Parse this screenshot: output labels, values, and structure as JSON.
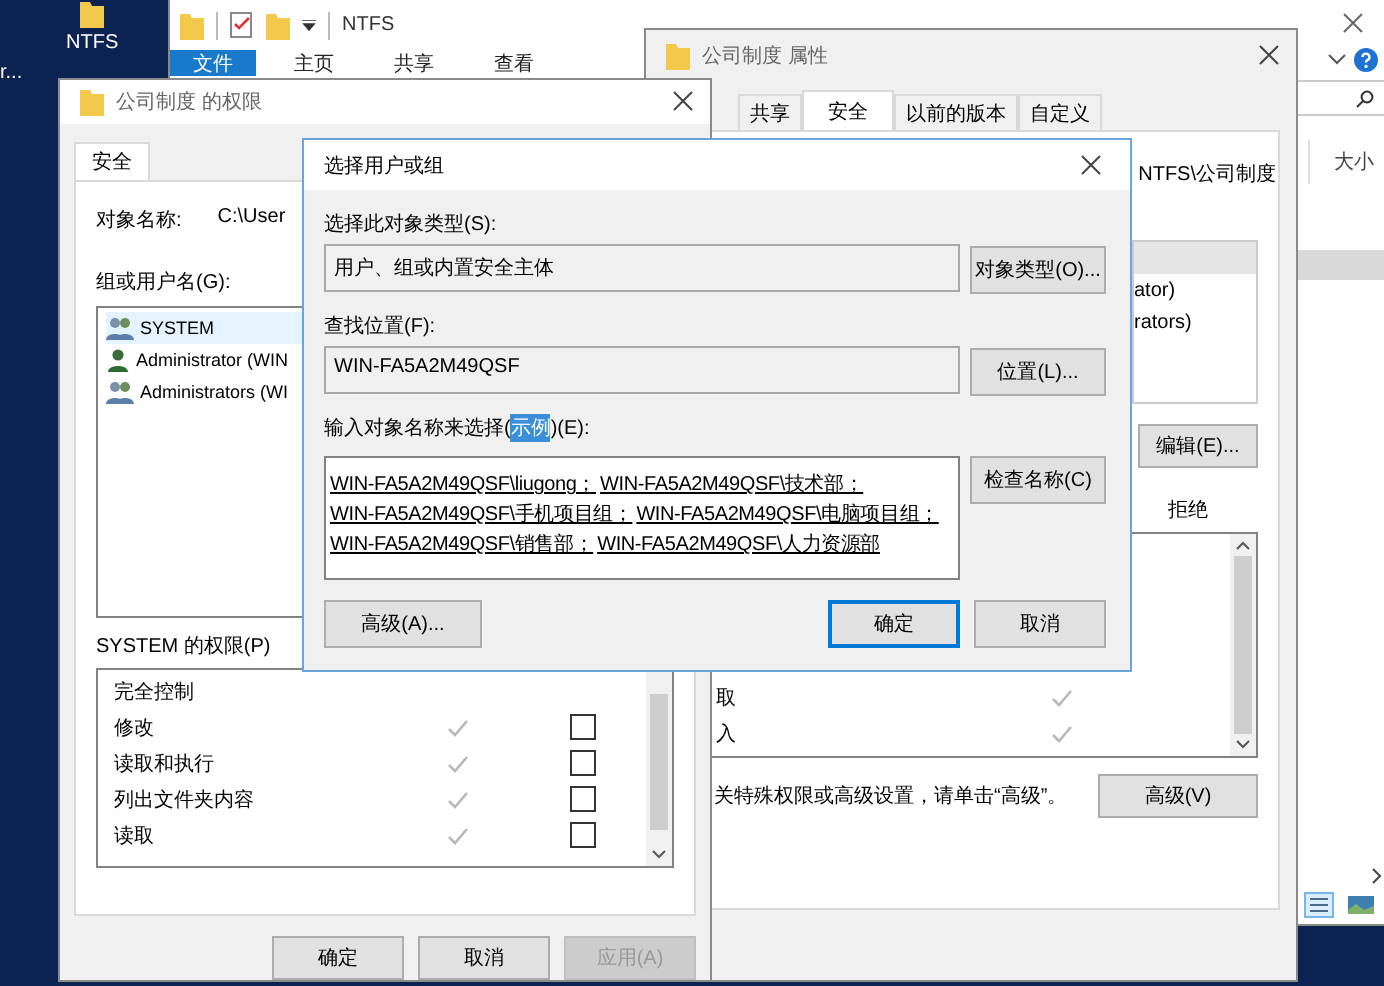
{
  "desktop": {
    "icons": [
      {
        "label": "NTFS"
      },
      {
        "label": "r..."
      }
    ]
  },
  "explorer": {
    "title": "NTFS",
    "ribbon_tabs": [
      {
        "label": "文件",
        "selected": true
      },
      {
        "label": "主页",
        "selected": false
      },
      {
        "label": "共享",
        "selected": false
      },
      {
        "label": "查看",
        "selected": false
      }
    ],
    "column_header": "大小"
  },
  "properties_window": {
    "title": "公司制度 属性",
    "tabs": [
      {
        "label": "共享",
        "selected": false
      },
      {
        "label": "安全",
        "selected": true
      },
      {
        "label": "以前的版本",
        "selected": false
      },
      {
        "label": "自定义",
        "selected": false
      }
    ],
    "object_name": "NTFS\\公司制度",
    "group_items": [
      {
        "selected": true
      },
      {
        "name": "ator)",
        "selected": false
      },
      {
        "name": "rators)",
        "selected": false
      }
    ],
    "edit_button": "编辑(E)...",
    "deny_header": "拒绝",
    "permissions": [
      {
        "name": "取",
        "allow": true
      },
      {
        "name": "入",
        "allow": true
      }
    ],
    "hint": "关特殊权限或高级设置，请单击“高级”。",
    "advanced_button": "高级(V)"
  },
  "permissions_window": {
    "title": "公司制度 的权限",
    "tab": "安全",
    "object_label": "对象名称:",
    "object_value": "C:\\User",
    "group_label": "组或用户名(G):",
    "users": [
      {
        "name": "SYSTEM",
        "kind": "group",
        "selected": true
      },
      {
        "name": "Administrator (WIN",
        "kind": "user",
        "selected": false
      },
      {
        "name": "Administrators (WI",
        "kind": "group",
        "selected": false
      }
    ],
    "permissions_label": "SYSTEM 的权限(P)",
    "permissions": [
      {
        "name": "完全控制"
      },
      {
        "name": "修改",
        "allow": true,
        "deny": false
      },
      {
        "name": "读取和执行",
        "allow": true,
        "deny": false
      },
      {
        "name": "列出文件夹内容",
        "allow": true,
        "deny": false
      },
      {
        "name": "读取",
        "allow": true,
        "deny": false
      }
    ],
    "buttons": [
      {
        "label": "确定",
        "disabled": false
      },
      {
        "label": "取消",
        "disabled": false
      },
      {
        "label": "应用(A)",
        "disabled": true
      }
    ]
  },
  "dialog": {
    "title": "选择用户或组",
    "type_label": "选择此对象类型(S):",
    "type_value": "用户、组或内置安全主体",
    "type_button": "对象类型(O)...",
    "location_label": "查找位置(F):",
    "location_value": "WIN-FA5A2M49QSF",
    "location_button": "位置(L)...",
    "names_label_prefix": "输入对象名称来选择(",
    "names_label_link": "示例",
    "names_label_suffix": ")(E):",
    "names": [
      [
        "WIN-FA5A2M49QSF\\liugong；",
        "WIN-FA5A2M49QSF\\技术部；"
      ],
      [
        "WIN-FA5A2M49QSF\\手机项目组；",
        "WIN-FA5A2M49QSF\\电脑项目组；"
      ],
      [
        "WIN-FA5A2M49QSF\\销售部；",
        "WIN-FA5A2M49QSF\\人力资源部"
      ]
    ],
    "check_button": "检查名称(C)",
    "buttons": [
      {
        "label": "高级(A)...",
        "default": false
      },
      {
        "label": "确定",
        "default": true
      },
      {
        "label": "取消",
        "default": false
      }
    ]
  }
}
